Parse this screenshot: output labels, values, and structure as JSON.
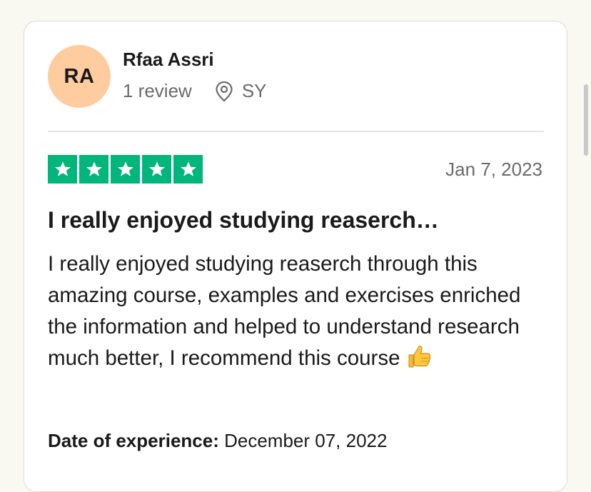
{
  "reviewer": {
    "initials": "RA",
    "name": "Rfaa Assri",
    "review_count": "1 review",
    "country": "SY",
    "avatar_color": "#ffcc9f"
  },
  "review": {
    "rating": 5,
    "rating_max": 5,
    "star_color": "#00b67a",
    "date": "Jan 7, 2023",
    "title": "I really enjoyed studying reaserch…",
    "body": "I really enjoyed studying reaserch through this amazing course, examples and exercises enriched the information and helped to understand research much better, I recommend this course",
    "body_icon": "thumbs-up-icon"
  },
  "experience": {
    "label": "Date of experience:",
    "value": "December 07, 2022"
  },
  "icons": {
    "location": "location-pin-icon",
    "star": "star-icon"
  }
}
